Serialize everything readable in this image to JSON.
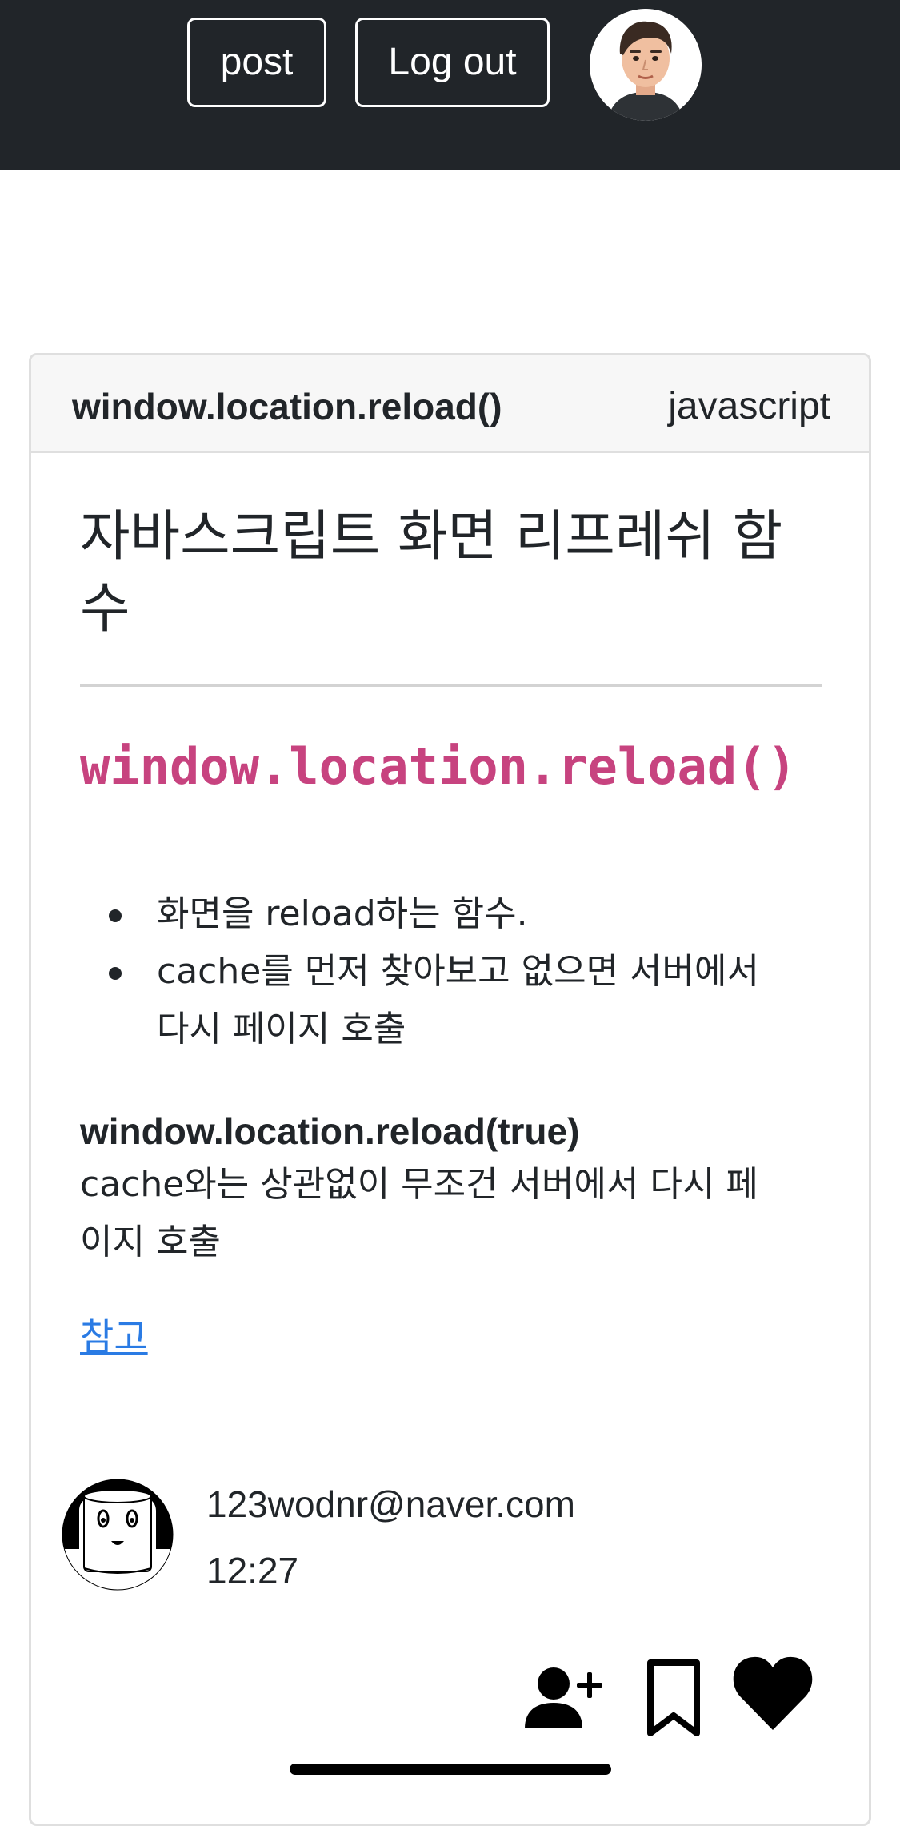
{
  "navbar": {
    "post_label": "post",
    "logout_label": "Log out",
    "avatar_icon": "user-avatar-icon"
  },
  "card": {
    "title": "window.location.reload()",
    "category": "javascript"
  },
  "post": {
    "heading": "자바스크립트 화면 리프레쉬 함수",
    "code_heading": "window.location.reload()",
    "bullets": [
      "화면을 reload하는 함수.",
      "cache를 먼저 찾아보고 없으면 서버에서 다시 페이지 호출"
    ],
    "strong_line": "window.location.reload(true)",
    "paragraph": "cache와는 상관없이 무조건 서버에서 다시 페이지 호출",
    "link_label": "참고"
  },
  "author": {
    "email": "123wodnr@naver.com",
    "time": "12:27",
    "avatar_icon": "author-avatar-icon"
  },
  "actions": {
    "follow_icon": "user-plus-icon",
    "bookmark_icon": "bookmark-icon",
    "like_icon": "heart-icon"
  },
  "colors": {
    "navbar_bg": "#212529",
    "code_color": "#c7437f",
    "link_color": "#2a7be4"
  }
}
